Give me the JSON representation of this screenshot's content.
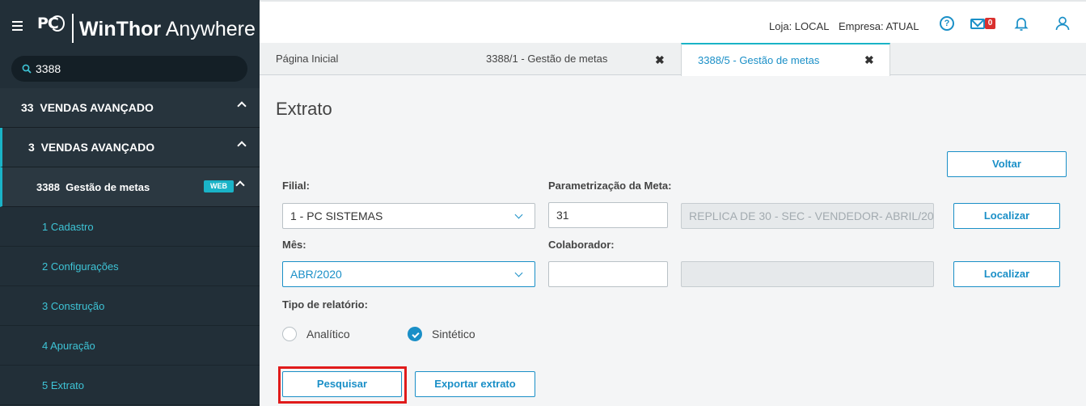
{
  "app": {
    "logo_text": "PC",
    "brand_bold": "WinThor",
    "brand_light": "Anywhere"
  },
  "sidebar": {
    "search_value": "3388",
    "groups": [
      {
        "code": "33",
        "label": "VENDAS AVANÇADO"
      },
      {
        "code": "3",
        "label": "VENDAS AVANÇADO"
      },
      {
        "code": "3388",
        "label": "Gestão de metas",
        "badge": "WEB"
      }
    ],
    "items": [
      {
        "label": "1  Cadastro"
      },
      {
        "label": "2  Configurações"
      },
      {
        "label": "3  Construção"
      },
      {
        "label": "4  Apuração"
      },
      {
        "label": "5  Extrato"
      }
    ]
  },
  "topbar": {
    "loja": "Loja: LOCAL",
    "empresa": "Empresa: ATUAL",
    "mail_count": "0"
  },
  "tabs": [
    {
      "label": "Página Inicial"
    },
    {
      "label": "3388/1 - Gestão de metas",
      "close": "✖"
    },
    {
      "label": "3388/5 - Gestão de metas",
      "close": "✖",
      "active": true
    }
  ],
  "form": {
    "title": "Extrato",
    "voltar": "Voltar",
    "filial_label": "Filial:",
    "filial_value": "1 - PC SISTEMAS",
    "param_label": "Parametrização da Meta:",
    "param_code": "31",
    "param_desc": "REPLICA DE 30 - SEC - VENDEDOR- ABRIL/20",
    "localizar": "Localizar",
    "mes_label": "Mês:",
    "mes_value": "ABR/2020",
    "colab_label": "Colaborador:",
    "colab_value": "",
    "tipo_label": "Tipo de relatório:",
    "analitico": "Analítico",
    "sintetico": "Sintético",
    "selected_tipo": "Sintético",
    "pesquisar": "Pesquisar",
    "exportar": "Exportar extrato"
  },
  "colors": {
    "sidebar_bg": "#222f38",
    "accent": "#1a8fc7",
    "teal": "#1ab3c7",
    "highlight": "#e01b1b"
  }
}
